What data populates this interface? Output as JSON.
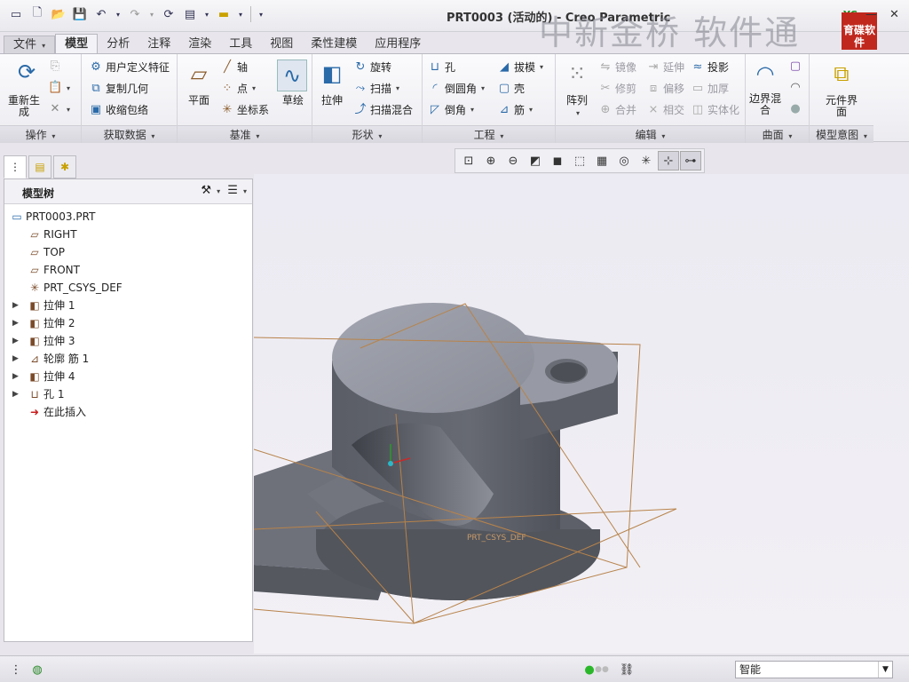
{
  "window": {
    "title": "PRT0003 (活动的) - Creo Parametric",
    "watermark": "中新金桥 软件通",
    "logo_text": "育碟软件",
    "logo_top": "YC",
    "controls": [
      "—",
      "✕"
    ]
  },
  "menu_tabs": [
    {
      "label": "文件",
      "icon": "dropdown"
    },
    {
      "label": "模型",
      "active": true
    },
    {
      "label": "分析"
    },
    {
      "label": "注释"
    },
    {
      "label": "渲染"
    },
    {
      "label": "工具"
    },
    {
      "label": "视图"
    },
    {
      "label": "柔性建模"
    },
    {
      "label": "应用程序"
    }
  ],
  "ribbon": {
    "operations": {
      "label": "操作",
      "regen": "重新生成"
    },
    "get_data": {
      "label": "获取数据",
      "items": [
        "用户定义特征",
        "复制几何",
        "收缩包络"
      ]
    },
    "datum": {
      "label": "基准",
      "plane": "平面",
      "items": [
        "轴",
        "点",
        "坐标系"
      ],
      "sketch": "草绘"
    },
    "shapes": {
      "label": "形状",
      "extrude": "拉伸",
      "items": [
        "旋转",
        "扫描",
        "扫描混合"
      ]
    },
    "engineering": {
      "label": "工程",
      "col1": [
        "孔",
        "倒圆角",
        "倒角"
      ],
      "col2": [
        "拔模",
        "壳",
        "筋"
      ]
    },
    "editing": {
      "label": "编辑",
      "pattern": "阵列",
      "col1": [
        "镜像",
        "修剪",
        "合并"
      ],
      "col2": [
        "延伸",
        "偏移",
        "相交"
      ],
      "col3": [
        "投影",
        "加厚",
        "实体化"
      ]
    },
    "surfaces": {
      "label": "曲面",
      "boundary": "边界混合"
    },
    "model_intent": {
      "label": "模型意图",
      "component": "元件界面"
    }
  },
  "model_tree": {
    "title": "模型树",
    "items": [
      {
        "label": "PRT0003.PRT",
        "icon": "part-icon",
        "expandable": false,
        "level": 0
      },
      {
        "label": "RIGHT",
        "icon": "datum-plane-icon",
        "expandable": false,
        "level": 1
      },
      {
        "label": "TOP",
        "icon": "datum-plane-icon",
        "expandable": false,
        "level": 1
      },
      {
        "label": "FRONT",
        "icon": "datum-plane-icon",
        "expandable": false,
        "level": 1
      },
      {
        "label": "PRT_CSYS_DEF",
        "icon": "csys-icon",
        "expandable": false,
        "level": 1
      },
      {
        "label": "拉伸 1",
        "icon": "extrude-icon",
        "expandable": true,
        "level": 1
      },
      {
        "label": "拉伸 2",
        "icon": "extrude-icon",
        "expandable": true,
        "level": 1
      },
      {
        "label": "拉伸 3",
        "icon": "extrude-icon",
        "expandable": true,
        "level": 1
      },
      {
        "label": "轮廓 筋 1",
        "icon": "rib-icon",
        "expandable": true,
        "level": 1
      },
      {
        "label": "拉伸 4",
        "icon": "extrude-icon",
        "expandable": true,
        "level": 1
      },
      {
        "label": "孔 1",
        "icon": "hole-icon",
        "expandable": true,
        "level": 1
      },
      {
        "label": "在此插入",
        "icon": "insert-arrow-icon",
        "expandable": false,
        "level": 1
      }
    ]
  },
  "viewport": {
    "csys_label": "PRT_CSYS_DEF"
  },
  "status": {
    "filter_value": "智能"
  }
}
